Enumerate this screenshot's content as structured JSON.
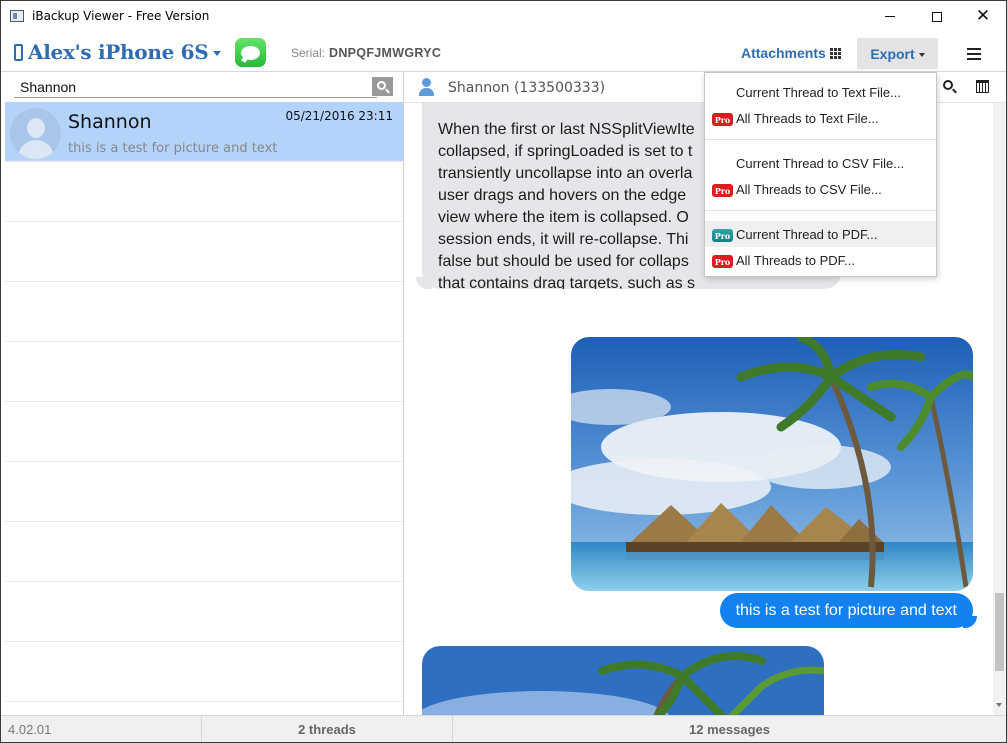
{
  "window": {
    "title": "iBackup Viewer - Free Version"
  },
  "toolbar": {
    "device_name": "Alex's iPhone 6S",
    "serial_label": "Serial:",
    "serial_value": "DNPQFJMWGRYC",
    "attachments_label": "Attachments",
    "export_label": "Export"
  },
  "search": {
    "value": "Shannon"
  },
  "threads": [
    {
      "name": "Shannon",
      "date": "05/21/2016 23:11",
      "preview": "this is a test for picture and text",
      "selected": true
    }
  ],
  "conversation": {
    "title": "Shannon (133500333)",
    "incoming_lines": [
      "When the first or last NSSplitViewIte",
      "collapsed, if springLoaded is set to t",
      "transiently uncollapse into an overla",
      "user drags and hovers on the edge",
      "view where the item is collapsed. O",
      "session ends, it will re-collapse. Thi",
      "false but should be used for collaps",
      "that contains drag targets, such as s"
    ],
    "outgoing_text": "this is a test for picture and text",
    "outgoing_color": "#1382f0",
    "incoming_color": "#e6e5ea"
  },
  "export_menu": {
    "items": [
      {
        "label": "Current Thread to Text File...",
        "pro": false
      },
      {
        "label": "All Threads to Text File...",
        "pro": true
      },
      {
        "label": "Current Thread to CSV File...",
        "pro": false
      },
      {
        "label": "All Threads to CSV File...",
        "pro": true
      },
      {
        "label": "Current Thread to PDF...",
        "pro": true,
        "highlighted": true
      },
      {
        "label": "All Threads to PDF...",
        "pro": true
      }
    ],
    "pro_badge": "Pro"
  },
  "status": {
    "version": "4.02.01",
    "threads": "2 threads",
    "messages": "12 messages"
  },
  "colors": {
    "accent": "#2f6db3",
    "selection": "#b3d3fb",
    "pro_badge": "#d81e1e"
  }
}
